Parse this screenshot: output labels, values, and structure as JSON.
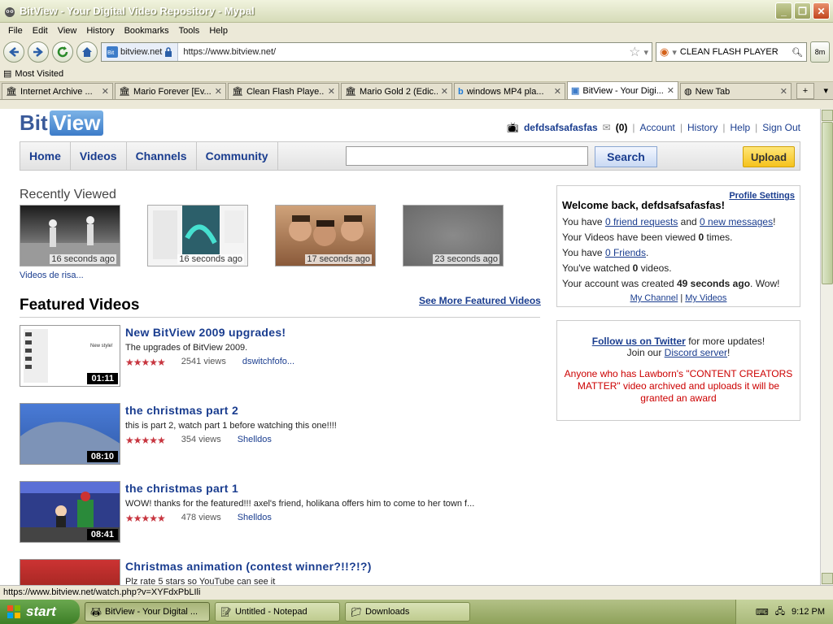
{
  "window": {
    "title": "BitView - Your Digital Video Repository - Mypal",
    "buttons": {
      "minimize": "_",
      "maximize": "❐",
      "close": "✕"
    }
  },
  "menu": [
    "File",
    "Edit",
    "View",
    "History",
    "Bookmarks",
    "Tools",
    "Help"
  ],
  "navbar": {
    "site_id": "bitview.net",
    "url": "https://www.bitview.net/",
    "search_text": "CLEAN FLASH PLAYER",
    "addon_label": "8m"
  },
  "bookmarks": {
    "most_visited": "Most Visited"
  },
  "tabs": [
    {
      "label": "Internet Archive ...",
      "active": false
    },
    {
      "label": "Mario Forever [Ev...",
      "active": false
    },
    {
      "label": "Clean Flash Playe...",
      "active": false
    },
    {
      "label": "Mario Gold 2 (Edic...",
      "active": false
    },
    {
      "label": "windows MP4 pla...",
      "active": false
    },
    {
      "label": "BitView - Your Digi...",
      "active": true
    },
    {
      "label": "New Tab",
      "active": false
    }
  ],
  "site": {
    "logo_bit": "Bit",
    "logo_view": "View",
    "user": {
      "name": "defdsafsafasfas",
      "messages": "(0)",
      "links": [
        "Account",
        "History",
        "Help",
        "Sign Out"
      ]
    },
    "nav": [
      "Home",
      "Videos",
      "Channels",
      "Community"
    ],
    "search_button": "Search",
    "upload_button": "Upload",
    "recently_viewed": {
      "title": "Recently Viewed",
      "items": [
        {
          "time": "16 seconds ago",
          "label": "Videos de risa..."
        },
        {
          "time": "16 seconds ago",
          "label": ""
        },
        {
          "time": "17 seconds ago",
          "label": ""
        },
        {
          "time": "23 seconds ago",
          "label": ""
        }
      ]
    },
    "featured": {
      "title": "Featured Videos",
      "see_more": "See More Featured Videos",
      "videos": [
        {
          "title": "New BitView 2009 upgrades!",
          "desc": "The upgrades of BitView 2009.",
          "rating": 4.5,
          "stars": "★★★★★",
          "views": "2541 views",
          "author": "dswitchfofo...",
          "duration": "01:11"
        },
        {
          "title": "the christmas part 2",
          "desc": "this is part 2, watch part 1 before watching this one!!!!",
          "rating": 4.5,
          "stars": "★★★★★",
          "views": "354 views",
          "author": "Shelldos",
          "duration": "08:10"
        },
        {
          "title": "the christmas part 1",
          "desc": "WOW! thanks for the featured!!! axel's friend, holikana offers him to come to her town f...",
          "rating": 4.5,
          "stars": "★★★★★",
          "views": "478 views",
          "author": "Shelldos",
          "duration": "08:41"
        },
        {
          "title": "Christmas animation (contest winner?!!?!?)",
          "desc": "Plz rate 5 stars so YouTube can see it",
          "rating": 0,
          "stars": "",
          "views": "",
          "author": "",
          "duration": ""
        }
      ]
    },
    "welcome_box": {
      "profile_settings": "Profile Settings",
      "welcome": "Welcome back, defdsafsafasfas!",
      "line1_pre": "You have ",
      "friend_requests": "0 friend requests",
      "line1_mid": " and ",
      "new_messages": "0 new messages",
      "line1_post": "!",
      "line2_pre": "Your Videos have been viewed ",
      "line2_num": "0",
      "line2_post": " times.",
      "line3_pre": "You have ",
      "friends": "0 Friends",
      "line3_post": ".",
      "line4_pre": "You've watched ",
      "line4_num": "0",
      "line4_post": " videos.",
      "line5_pre": "Your account was created ",
      "line5_bold": "49 seconds ago",
      "line5_post": ". Wow!",
      "my_channel": "My Channel",
      "sep": "|",
      "my_videos": "My Videos"
    },
    "social_box": {
      "twitter_link": "Follow us on Twitter",
      "twitter_post": " for more updates!",
      "discord_pre": "Join our ",
      "discord_link": "Discord server",
      "discord_post": "!",
      "notice": "Anyone who has Lawborn's \"CONTENT CREATORS MATTER\" video archived and uploads it will be granted an award"
    }
  },
  "status_url": "https://www.bitview.net/watch.php?v=XYFdxPbLIli",
  "taskbar": {
    "start": "start",
    "items": [
      {
        "label": "BitView - Your Digital ...",
        "active": true
      },
      {
        "label": "Untitled - Notepad",
        "active": false
      },
      {
        "label": "Downloads",
        "active": false
      }
    ],
    "clock": "9:12 PM"
  },
  "colors": {
    "link": "#1a3d8f",
    "star": "#c7353f",
    "upload": "#f5c21c",
    "notice": "#cc0000"
  }
}
